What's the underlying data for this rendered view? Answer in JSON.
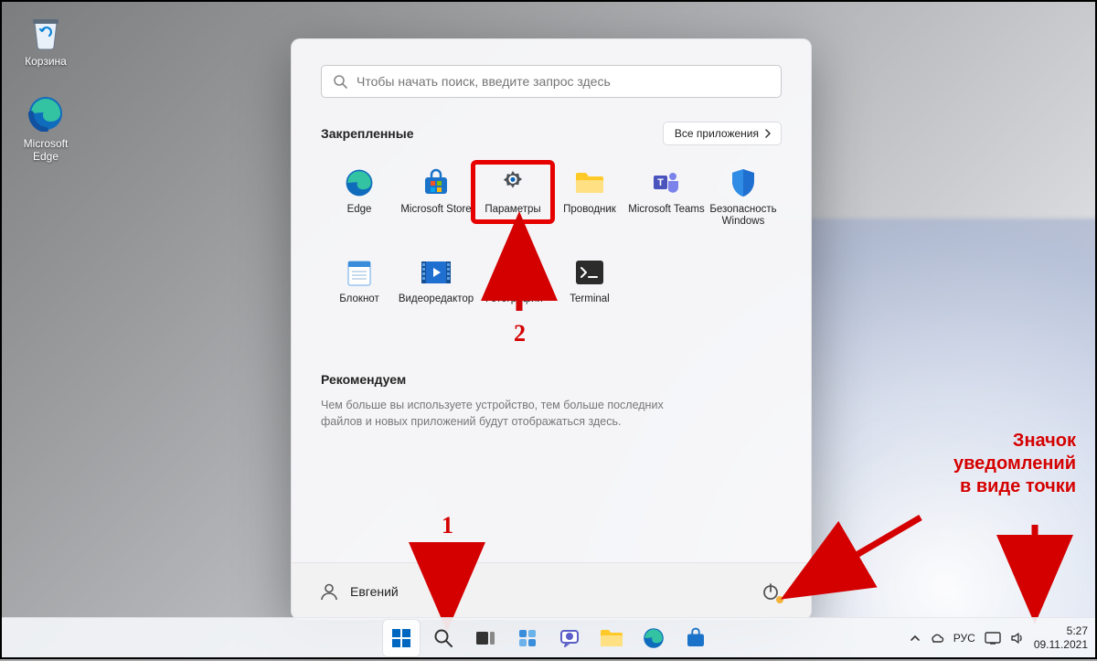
{
  "desktop": {
    "recycle_label": "Корзина",
    "edge_label": "Microsoft Edge"
  },
  "start": {
    "search_placeholder": "Чтобы начать поиск, введите запрос здесь",
    "pinned_title": "Закрепленные",
    "all_apps_label": "Все приложения",
    "pins": [
      {
        "label": "Edge"
      },
      {
        "label": "Microsoft Store"
      },
      {
        "label": "Параметры"
      },
      {
        "label": "Проводник"
      },
      {
        "label": "Microsoft Teams"
      },
      {
        "label": "Безопасность Windows"
      },
      {
        "label": "Блокнот"
      },
      {
        "label": "Видеоредактор"
      },
      {
        "label": "Фотографии"
      },
      {
        "label": "Terminal"
      }
    ],
    "recommend_title": "Рекомендуем",
    "recommend_text": "Чем больше вы используете устройство, тем больше последних файлов и новых приложений будут отображаться здесь.",
    "user_name": "Евгений"
  },
  "annotations": {
    "num1": "1",
    "num2": "2",
    "text_line1": "Значок",
    "text_line2": "уведомлений",
    "text_line3": "в виде точки"
  },
  "taskbar": {
    "lang": "РУС",
    "time": "5:27",
    "date": "09.11.2021"
  },
  "colors": {
    "highlight": "#e60000",
    "accent_blue": "#0067c0"
  }
}
